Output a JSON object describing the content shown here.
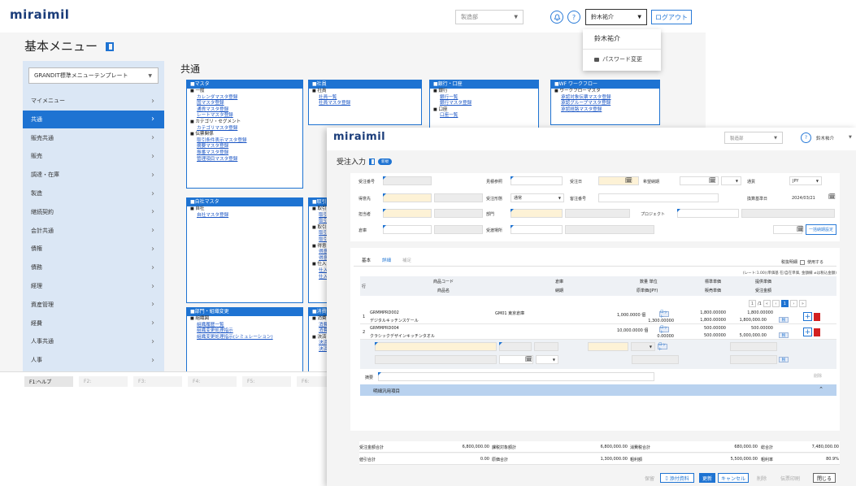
{
  "win1": {
    "logo": "miraimil",
    "dept_select": "製造部",
    "notification_icon": "bell-icon",
    "help_icon": "question-icon",
    "user_select": "鈴木祐介",
    "logout_button": "ログアウト",
    "user_menu": {
      "name": "鈴木祐介",
      "password_change": "パスワード変更"
    },
    "menu_title": "基本メニュー",
    "template_select": "GRANDIT標準メニューテンプレート",
    "sidebar": [
      "マイメニュー",
      "共通",
      "販売共通",
      "販売",
      "調達・在庫",
      "製造",
      "継続契約",
      "会計共通",
      "債権",
      "債務",
      "経理",
      "資産管理",
      "経費",
      "人事共通",
      "人事"
    ],
    "sidebar_active": 1,
    "section_title": "共通",
    "panels": {
      "master": {
        "title": "■マスタ",
        "lines": [
          {
            "t": "g",
            "v": "一般"
          },
          {
            "t": "l",
            "v": "カレンダマスタ登録"
          },
          {
            "t": "l",
            "v": "国マスタ登録"
          },
          {
            "t": "l",
            "v": "通貨マスタ登録"
          },
          {
            "t": "l",
            "v": "レートマスタ登録"
          },
          {
            "t": "g",
            "v": "カテゴリ・セグメント"
          },
          {
            "t": "l",
            "v": "カテゴリマスタ登録"
          },
          {
            "t": "g",
            "v": "伝票関係"
          },
          {
            "t": "l",
            "v": "取引条件表示マスタ登録"
          },
          {
            "t": "l",
            "v": "摘要マスタ登録"
          },
          {
            "t": "l",
            "v": "振番マスタ登録"
          },
          {
            "t": "l",
            "v": "管理項目マスタ登録"
          }
        ]
      },
      "company": {
        "title": "■社員",
        "lines": [
          {
            "t": "g",
            "v": "社員"
          },
          {
            "t": "l",
            "v": "社員一覧"
          },
          {
            "t": "l",
            "v": "社員マスタ登録"
          }
        ]
      },
      "bank": {
        "title": "■銀行・口座",
        "lines": [
          {
            "t": "g",
            "v": "銀行"
          },
          {
            "t": "l",
            "v": "銀行一覧"
          },
          {
            "t": "l",
            "v": "銀行マスタ登録"
          },
          {
            "t": "g",
            "v": "口座"
          },
          {
            "t": "l",
            "v": "口座一覧"
          }
        ]
      },
      "wf": {
        "title": "■WF ワークフロー",
        "lines": [
          {
            "t": "g",
            "v": "ワークフローマスタ"
          },
          {
            "t": "l",
            "v": "承認対象伝票マスタ登録"
          },
          {
            "t": "l",
            "v": "承認グループマスタ登録"
          },
          {
            "t": "l",
            "v": "承認経路マスタ登録"
          }
        ]
      },
      "own": {
        "title": "■自社マスタ",
        "lines": [
          {
            "t": "g",
            "v": "自社"
          },
          {
            "t": "l",
            "v": "自社マスタ登録"
          }
        ]
      },
      "trade": {
        "title": "■取引先",
        "lines": [
          {
            "t": "g",
            "v": "取引"
          },
          {
            "t": "l",
            "v": "取引"
          },
          {
            "t": "l",
            "v": "取引"
          },
          {
            "t": "g",
            "v": "取引"
          },
          {
            "t": "l",
            "v": "取引"
          },
          {
            "t": "l",
            "v": "取引"
          },
          {
            "t": "g",
            "v": "得意"
          },
          {
            "t": "l",
            "v": "得意"
          },
          {
            "t": "l",
            "v": "得意"
          },
          {
            "t": "g",
            "v": "仕入"
          },
          {
            "t": "l",
            "v": "仕入"
          },
          {
            "t": "l",
            "v": "仕入"
          }
        ]
      },
      "org": {
        "title": "■部門・組織変更",
        "lines": [
          {
            "t": "g",
            "v": "組織図"
          },
          {
            "t": "l",
            "v": "組織履歴一覧"
          },
          {
            "t": "l",
            "v": "組織変更処理指示"
          },
          {
            "t": "l",
            "v": "組織変更処理指示(シミュレーション)"
          }
        ]
      },
      "tax": {
        "title": "■消費税",
        "lines": [
          {
            "t": "g",
            "v": "消費"
          },
          {
            "t": "l",
            "v": "消費"
          },
          {
            "t": "l",
            "v": "消費"
          },
          {
            "t": "g",
            "v": "決済"
          },
          {
            "t": "l",
            "v": "決済"
          },
          {
            "t": "l",
            "v": "決済"
          }
        ]
      }
    },
    "fkeys": [
      "F1:ヘルプ",
      "F2:",
      "F3:",
      "F4:",
      "F5:",
      "F6:"
    ]
  },
  "win2": {
    "logo": "miraimil",
    "dept_select": "製造部",
    "help_icon": "question-icon",
    "user": "鈴木祐介",
    "title": "受注入力",
    "badge": "新規",
    "form": {
      "order_no": "受注番号",
      "quote_ref": "見積参照",
      "order_date": "受注日",
      "desired_date": "希望納期",
      "currency": "通貨",
      "currency_value": "JPY",
      "customer": "得意先",
      "trade_type": "受注形態",
      "trade_type_value": "通常",
      "customer_no": "客注番号",
      "rate_date": "換算基準日",
      "rate_date_value": "2024/03/21",
      "staff": "担当者",
      "dept": "部門",
      "project": "プロジェクト",
      "warehouse": "倉庫",
      "delivery": "受渡場所",
      "bulk_button": "一括納期設定"
    },
    "tabs": [
      "基本",
      "詳細",
      "補足"
    ],
    "tab_active": 1,
    "detail_hidden": "税抜明細",
    "use_label": "使用する",
    "rate_note": "(レート:1.00)(単価基 在/自在単価, 金額欄 ≠は税込金額)",
    "table_head": {
      "row": "行",
      "code": "商品コード",
      "name": "商品名",
      "wh": "倉庫",
      "due": "納期",
      "qty": "数量 単位",
      "cost_price": "原単価(JPY)",
      "std_price": "標準単価",
      "sale_price": "販売単価",
      "offer_price": "提供単価",
      "order_amount": "受注金額"
    },
    "pager": {
      "page": "1",
      "total": "/1"
    },
    "rows": [
      {
        "no": "1",
        "code": "GRMMPRD002",
        "name": "デジタルキッチンスケール",
        "wh": "GM01 東京倉庫",
        "qty": "1,000.0000 個",
        "tag": "ロット",
        "cost": "1,300.00000",
        "std": "1,800.00000",
        "sale": "1,800.00000",
        "offer": "1,800.00000",
        "amount": "1,800,000.00"
      },
      {
        "no": "2",
        "code": "GRMMPRD004",
        "name": "クラシックデザインキッチンタオル",
        "wh": "",
        "qty": "10,000.0000 個",
        "tag": "ロット",
        "cost": "0.00000",
        "std": "500.00000",
        "sale": "500.00000",
        "offer": "500.00000",
        "amount": "5,000,000.00"
      }
    ],
    "memo_label": "摘要",
    "detail_items": "明細汎用項目",
    "summary": {
      "order_total_label": "受注金額合計",
      "order_total": "6,800,000.00",
      "taxable_label": "課税対象額計",
      "taxable": "6,800,000.00",
      "tax_label": "消費税合計",
      "tax": "680,000.00",
      "grand_label": "総合計",
      "grand": "7,480,000.00",
      "discount_label": "値引合計",
      "discount": "0.00",
      "cost_label": "原価合計",
      "cost": "1,300,000.00",
      "profit_label": "粗利額",
      "profit": "5,500,000.00",
      "margin_label": "粗利率",
      "margin": "80.9%"
    },
    "actions": {
      "temp": "保留",
      "attach": "添付資料",
      "update": "更新",
      "cancel": "キャンセル",
      "delete": "削除",
      "print": "伝票印刷",
      "close": "閉じる"
    },
    "fkeys": [
      {
        "k": "F1:ヘルプ",
        "on": true
      },
      {
        "k": "F2:キャンセル",
        "on": true
      },
      {
        "k": "F3:削除",
        "on": false
      },
      {
        "k": "F4:行挿入",
        "on": false
      },
      {
        "k": "F5:参照",
        "on": false
      },
      {
        "k": "F6:更新",
        "on": true
      },
      {
        "k": "F7:",
        "on": false
      },
      {
        "k": "F8:",
        "on": false
      },
      {
        "k": "F9:タブ切替",
        "on": true
      },
      {
        "k": "F10:伝票印刷",
        "on": false
      },
      {
        "k": "F11:画面印刷",
        "on": true
      },
      {
        "k": "F12:閉じる",
        "on": true
      }
    ]
  },
  "colors": {
    "accent": "#1e73d2",
    "brand": "#1b3d7a",
    "danger": "#d32020",
    "yellow_field": "#fdf2d6"
  }
}
